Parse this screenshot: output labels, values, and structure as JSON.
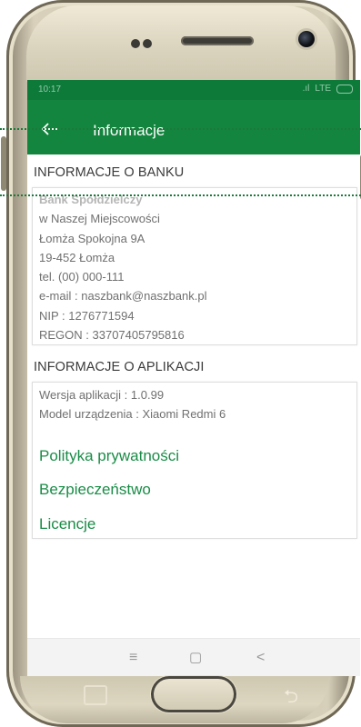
{
  "status_bar": {
    "time": "10:17",
    "signal": "LTE"
  },
  "app_bar": {
    "back_icon": "arrow-left-icon",
    "title": "Informacje"
  },
  "bank_section": {
    "title": "INFORMACJE O BANKU",
    "name": "Bank Spółdzielczy",
    "lines": [
      "w Naszej Miejscowości",
      "Łomża Spokojna 9A",
      "19-452 Łomża",
      "tel. (00) 000-111",
      "e-mail : naszbank@naszbank.pl",
      "NIP : 1276771594",
      "REGON : 33707405795816"
    ]
  },
  "app_section": {
    "title": "INFORMACJE O APLIKACJI",
    "version": "Wersja aplikacji : 1.0.99",
    "device": "Model urządzenia : Xiaomi Redmi 6",
    "links": {
      "privacy": "Polityka prywatności",
      "security": "Bezpieczeństwo",
      "licenses": "Licencje"
    }
  },
  "nav_bar": {
    "menu": "≡",
    "home": "▢",
    "back": "<"
  },
  "colors": {
    "brand_dark": "#0d7a3a",
    "brand": "#14853f",
    "link": "#1a8c47"
  }
}
